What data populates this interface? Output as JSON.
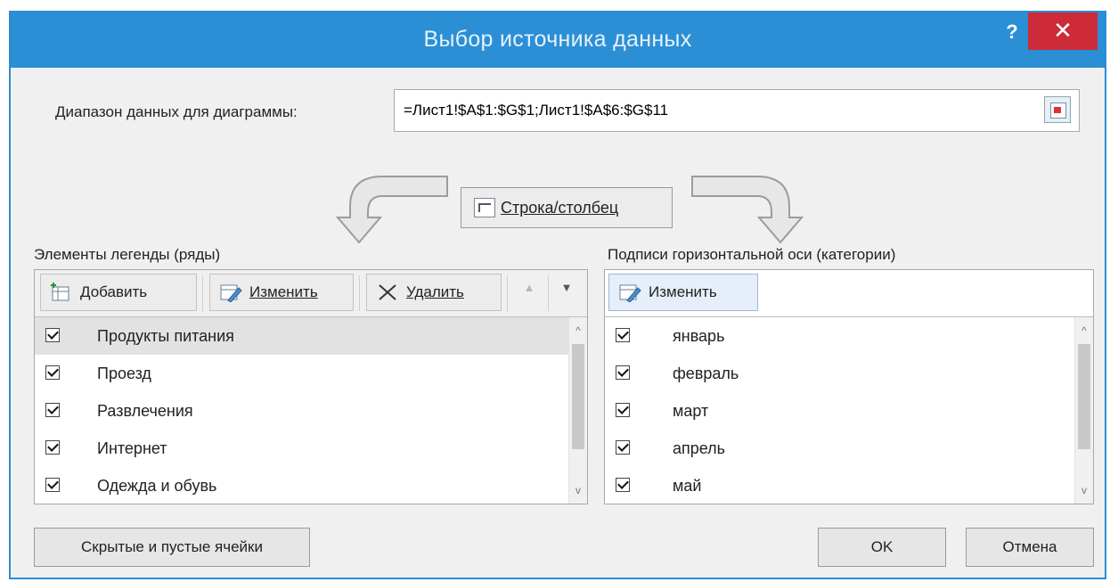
{
  "dialog": {
    "title": "Выбор источника данных",
    "help_label": "?",
    "close_label": "✕"
  },
  "range": {
    "label": "Диапазон данных для диаграммы:",
    "value": "=Лист1!$A$1:$G$1;Лист1!$A$6:$G$11"
  },
  "switch_button": "Строка/столбец",
  "legend": {
    "label": "Элементы легенды (ряды)",
    "add": "Добавить",
    "edit": "Изменить",
    "delete": "Удалить",
    "up_icon": "▲",
    "down_icon": "▼",
    "items": [
      {
        "label": "Продукты питания",
        "checked": true,
        "selected": true
      },
      {
        "label": "Проезд",
        "checked": true
      },
      {
        "label": "Развлечения",
        "checked": true
      },
      {
        "label": "Интернет",
        "checked": true
      },
      {
        "label": "Одежда и обувь",
        "checked": true
      }
    ]
  },
  "axis": {
    "label": "Подписи горизонтальной оси (категории)",
    "edit": "Изменить",
    "items": [
      {
        "label": "январь",
        "checked": true
      },
      {
        "label": "февраль",
        "checked": true
      },
      {
        "label": "март",
        "checked": true
      },
      {
        "label": "апрель",
        "checked": true
      },
      {
        "label": "май",
        "checked": true
      }
    ]
  },
  "scroll": {
    "up": "^",
    "down": "v"
  },
  "hidden_cells_button": "Скрытые и пустые ячейки",
  "ok_button": "OK",
  "cancel_button": "Отмена",
  "colors": {
    "titlebar": "#2b8fd6",
    "close": "#cd2a3a"
  }
}
